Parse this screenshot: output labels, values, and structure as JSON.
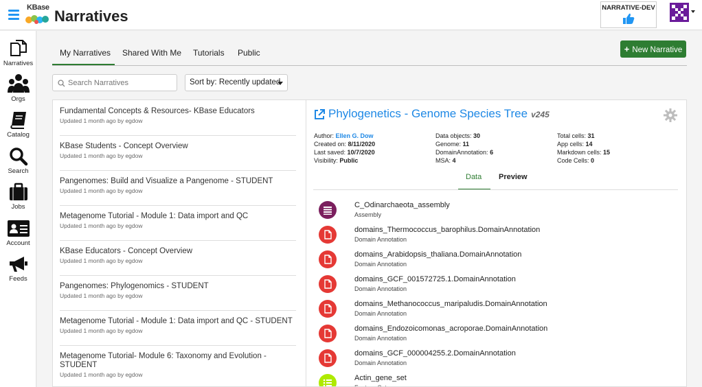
{
  "header": {
    "logo_text": "KBase",
    "title": "Narratives",
    "env_label": "NARRATIVE-DEV",
    "colors": {
      "accent": "#2196f3",
      "avatar": "#6a1b9a"
    }
  },
  "sidebar": {
    "items": [
      {
        "label": "Narratives",
        "icon": "narratives-icon"
      },
      {
        "label": "Orgs",
        "icon": "orgs-icon"
      },
      {
        "label": "Catalog",
        "icon": "catalog-icon"
      },
      {
        "label": "Search",
        "icon": "search-icon"
      },
      {
        "label": "Jobs",
        "icon": "jobs-icon"
      },
      {
        "label": "Account",
        "icon": "account-icon"
      },
      {
        "label": "Feeds",
        "icon": "feeds-icon"
      }
    ]
  },
  "tabs": [
    {
      "label": "My Narratives",
      "active": true
    },
    {
      "label": "Shared With Me"
    },
    {
      "label": "Tutorials"
    },
    {
      "label": "Public"
    }
  ],
  "new_button": "New Narrative",
  "search": {
    "placeholder": "Search Narratives"
  },
  "sort": {
    "label": "Sort by: Recently updated"
  },
  "narratives": [
    {
      "title": "Fundamental Concepts & Resources- KBase Educators",
      "updated": "Updated 1 month ago by egdow"
    },
    {
      "title": "KBase Students - Concept Overview",
      "updated": "Updated 1 month ago by egdow"
    },
    {
      "title": "Pangenomes: Build and Visualize a Pangenome - STUDENT",
      "updated": "Updated 1 month ago by egdow"
    },
    {
      "title": "Metagenome Tutorial - Module 1: Data import and QC",
      "updated": "Updated 1 month ago by egdow"
    },
    {
      "title": "KBase Educators - Concept Overview",
      "updated": "Updated 1 month ago by egdow"
    },
    {
      "title": "Pangenomes: Phylogenomics - STUDENT",
      "updated": "Updated 1 month ago by egdow"
    },
    {
      "title": "Metagenome Tutorial - Module 1: Data import and QC - STUDENT",
      "updated": "Updated 1 month ago by egdow"
    },
    {
      "title": "Metagenome Tutorial- Module 6: Taxonomy and Evolution - STUDENT",
      "updated": "Updated 1 month ago by egdow"
    }
  ],
  "detail": {
    "title": "Phylogenetics - Genome Species Tree",
    "version": "v245",
    "meta_col1": {
      "author_label": "Author:",
      "author": "Ellen G. Dow",
      "created_label": "Created on:",
      "created": "8/11/2020",
      "saved_label": "Last saved:",
      "saved": "10/7/2020",
      "visibility_label": "Visibility:",
      "visibility": "Public"
    },
    "meta_col2": {
      "data_objects_label": "Data objects:",
      "data_objects": "30",
      "genome_label": "Genome:",
      "genome": "11",
      "domain_label": "DomainAnnotation:",
      "domain": "6",
      "msa_label": "MSA:",
      "msa": "4"
    },
    "meta_col3": {
      "total_label": "Total cells:",
      "total": "31",
      "app_label": "App cells:",
      "app": "14",
      "markdown_label": "Markdown cells:",
      "markdown": "15",
      "code_label": "Code Cells:",
      "code": "0"
    },
    "tabs": [
      "Data",
      "Preview"
    ],
    "objects": [
      {
        "name": "C_Odinarchaeota_assembly",
        "type": "Assembly",
        "icon": "assembly-icon",
        "color": "#7b1f5e"
      },
      {
        "name": "domains_Thermococcus_barophilus.DomainAnnotation",
        "type": "Domain Annotation",
        "icon": "document-icon",
        "color": "#e53935"
      },
      {
        "name": "domains_Arabidopsis_thaliana.DomainAnnotation",
        "type": "Domain Annotation",
        "icon": "document-icon",
        "color": "#e53935"
      },
      {
        "name": "domains_GCF_001572725.1.DomainAnnotation",
        "type": "Domain Annotation",
        "icon": "document-icon",
        "color": "#e53935"
      },
      {
        "name": "domains_Methanococcus_maripaludis.DomainAnnotation",
        "type": "Domain Annotation",
        "icon": "document-icon",
        "color": "#e53935"
      },
      {
        "name": "domains_Endozoicomonas_acroporae.DomainAnnotation",
        "type": "Domain Annotation",
        "icon": "document-icon",
        "color": "#e53935"
      },
      {
        "name": "domains_GCF_000004255.2.DomainAnnotation",
        "type": "Domain Annotation",
        "icon": "document-icon",
        "color": "#e53935"
      },
      {
        "name": "Actin_gene_set",
        "type": "Feature Set",
        "icon": "list-icon",
        "color": "#aeea00"
      }
    ]
  }
}
